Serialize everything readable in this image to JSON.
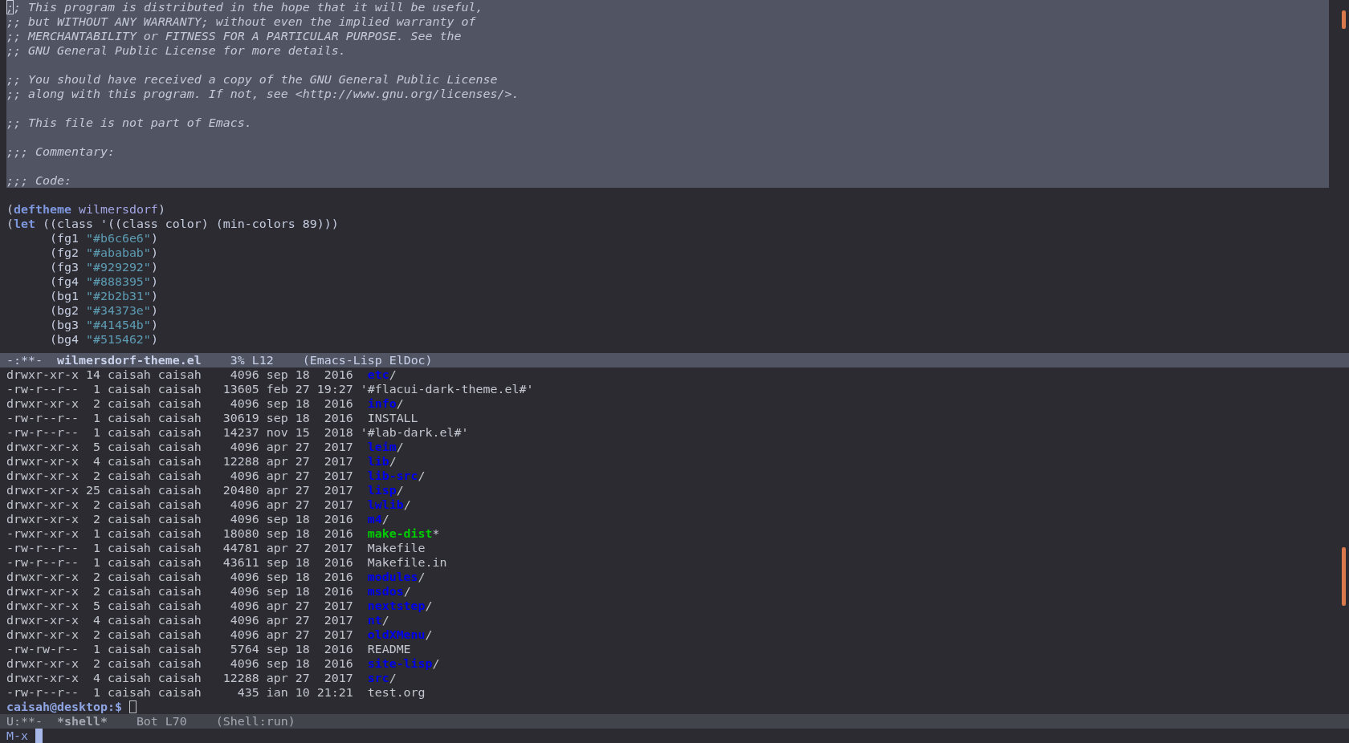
{
  "editor": {
    "lines": [
      {
        "region": true,
        "segments": [
          {
            "kind": "comment",
            "text": ";",
            "cursor": true
          },
          {
            "kind": "comment",
            "text": "; This program is distributed in the hope that it will be useful,",
            "cursor": false
          }
        ]
      },
      {
        "region": true,
        "segments": [
          {
            "kind": "comment",
            "text": ";; but WITHOUT ANY WARRANTY; without even the implied warranty of"
          }
        ]
      },
      {
        "region": true,
        "segments": [
          {
            "kind": "comment",
            "text": ";; MERCHANTABILITY or FITNESS FOR A PARTICULAR PURPOSE. See the"
          }
        ]
      },
      {
        "region": true,
        "segments": [
          {
            "kind": "comment",
            "text": ";; GNU General Public License for more details."
          }
        ]
      },
      {
        "region": true
      },
      {
        "region": true,
        "segments": [
          {
            "kind": "comment",
            "text": ";; You should have received a copy of the GNU General Public License"
          }
        ]
      },
      {
        "region": true,
        "segments": [
          {
            "kind": "comment",
            "text": ";; along with this program. If not, see <http://www.gnu.org/licenses/>."
          }
        ]
      },
      {
        "region": true
      },
      {
        "region": true,
        "segments": [
          {
            "kind": "comment",
            "text": ";; This file is not part of Emacs."
          }
        ]
      },
      {
        "region": true
      },
      {
        "region": true,
        "segments": [
          {
            "kind": "comment",
            "text": ";;; Commentary:"
          }
        ]
      },
      {
        "region": true
      },
      {
        "region": true,
        "segments": [
          {
            "kind": "comment",
            "text": ";;; Code:"
          }
        ]
      },
      {
        "region": false
      },
      {
        "region": false,
        "segments": [
          {
            "kind": "plain",
            "text": "("
          },
          {
            "kind": "keyword",
            "text": "deftheme"
          },
          {
            "kind": "name",
            "text": "wilmersdorf"
          },
          {
            "kind": "plain",
            "text": ")"
          }
        ]
      },
      {
        "region": false,
        "segments": [
          {
            "kind": "plain",
            "text": "("
          },
          {
            "kind": "keyword",
            "text": "let"
          },
          {
            "kind": "plain",
            "text": " ((class '((class color) (min-colors 89)))"
          }
        ]
      },
      {
        "region": false,
        "indented": true,
        "segments": [
          {
            "kind": "plain",
            "text": "(fg1 "
          },
          {
            "kind": "string",
            "text": "\"#b6c6e6\""
          },
          {
            "kind": "plain",
            "text": ")"
          }
        ]
      },
      {
        "region": false,
        "indented": true,
        "segments": [
          {
            "kind": "plain",
            "text": "(fg2 "
          },
          {
            "kind": "string",
            "text": "\"#ababab\""
          },
          {
            "kind": "plain",
            "text": ")"
          }
        ]
      },
      {
        "region": false,
        "indented": true,
        "segments": [
          {
            "kind": "plain",
            "text": "(fg3 "
          },
          {
            "kind": "string",
            "text": "\"#929292\""
          },
          {
            "kind": "plain",
            "text": ")"
          }
        ]
      },
      {
        "region": false,
        "indented": true,
        "segments": [
          {
            "kind": "plain",
            "text": "(fg4 "
          },
          {
            "kind": "string",
            "text": "\"#888395\""
          },
          {
            "kind": "plain",
            "text": ")"
          }
        ]
      },
      {
        "region": false,
        "indented": true,
        "segments": [
          {
            "kind": "plain",
            "text": "(bg1 "
          },
          {
            "kind": "string",
            "text": "\"#2b2b31\""
          },
          {
            "kind": "plain",
            "text": ")"
          }
        ]
      },
      {
        "region": false,
        "indented": true,
        "segments": [
          {
            "kind": "plain",
            "text": "(bg2 "
          },
          {
            "kind": "string",
            "text": "\"#34373e\""
          },
          {
            "kind": "plain",
            "text": ")"
          }
        ]
      },
      {
        "region": false,
        "indented": true,
        "segments": [
          {
            "kind": "plain",
            "text": "(bg3 "
          },
          {
            "kind": "string",
            "text": "\"#41454b\""
          },
          {
            "kind": "plain",
            "text": ")"
          }
        ]
      },
      {
        "region": false,
        "indented": true,
        "segments": [
          {
            "kind": "plain",
            "text": "(bg4 "
          },
          {
            "kind": "string",
            "text": "\"#515462\""
          },
          {
            "kind": "plain",
            "text": ")"
          }
        ]
      }
    ]
  },
  "editor_mode_line": {
    "active": true,
    "state": "-:**-",
    "buffer": "wilmersdorf-theme.el",
    "position": "3% L12",
    "modes": "(Emacs-Lisp ElDoc)"
  },
  "shell": {
    "rows": [
      {
        "details": "drwxr-xr-x 14 caisah caisah    4096 sep 18  2016",
        "kind": "dir",
        "name": "etc",
        "suffix": "/"
      },
      {
        "details": "-rw-r--r--  1 caisah caisah   13605 feb 27 19:27",
        "kind": "quoted",
        "name": "'#flacui-dark-theme.el#'"
      },
      {
        "details": "drwxr-xr-x  2 caisah caisah    4096 sep 18  2016",
        "kind": "dir",
        "name": "info",
        "suffix": "/"
      },
      {
        "details": "-rw-r--r--  1 caisah caisah   30619 sep 18  2016",
        "kind": "file",
        "name": "INSTALL"
      },
      {
        "details": "-rw-r--r--  1 caisah caisah   14237 nov 15  2018",
        "kind": "quoted",
        "name": "'#lab-dark.el#'"
      },
      {
        "details": "drwxr-xr-x  5 caisah caisah    4096 apr 27  2017",
        "kind": "dir",
        "name": "leim",
        "suffix": "/"
      },
      {
        "details": "drwxr-xr-x  4 caisah caisah   12288 apr 27  2017",
        "kind": "dir",
        "name": "lib",
        "suffix": "/"
      },
      {
        "details": "drwxr-xr-x  2 caisah caisah    4096 apr 27  2017",
        "kind": "dir",
        "name": "lib-src",
        "suffix": "/"
      },
      {
        "details": "drwxr-xr-x 25 caisah caisah   20480 apr 27  2017",
        "kind": "dir",
        "name": "lisp",
        "suffix": "/"
      },
      {
        "details": "drwxr-xr-x  2 caisah caisah    4096 apr 27  2017",
        "kind": "dir",
        "name": "lwlib",
        "suffix": "/"
      },
      {
        "details": "drwxr-xr-x  2 caisah caisah    4096 sep 18  2016",
        "kind": "dir",
        "name": "m4",
        "suffix": "/"
      },
      {
        "details": "-rwxr-xr-x  1 caisah caisah   18080 sep 18  2016",
        "kind": "exec",
        "name": "make-dist",
        "suffix": "*"
      },
      {
        "details": "-rw-r--r--  1 caisah caisah   44781 apr 27  2017",
        "kind": "file",
        "name": "Makefile"
      },
      {
        "details": "-rw-r--r--  1 caisah caisah   43611 sep 18  2016",
        "kind": "file",
        "name": "Makefile.in"
      },
      {
        "details": "drwxr-xr-x  2 caisah caisah    4096 sep 18  2016",
        "kind": "dir",
        "name": "modules",
        "suffix": "/"
      },
      {
        "details": "drwxr-xr-x  2 caisah caisah    4096 sep 18  2016",
        "kind": "dir",
        "name": "msdos",
        "suffix": "/"
      },
      {
        "details": "drwxr-xr-x  5 caisah caisah    4096 apr 27  2017",
        "kind": "dir",
        "name": "nextstep",
        "suffix": "/"
      },
      {
        "details": "drwxr-xr-x  4 caisah caisah    4096 apr 27  2017",
        "kind": "dir",
        "name": "nt",
        "suffix": "/"
      },
      {
        "details": "drwxr-xr-x  2 caisah caisah    4096 apr 27  2017",
        "kind": "dir",
        "name": "oldXMenu",
        "suffix": "/"
      },
      {
        "details": "-rw-rw-r--  1 caisah caisah    5764 sep 18  2016",
        "kind": "file",
        "name": "README"
      },
      {
        "details": "drwxr-xr-x  2 caisah caisah    4096 sep 18  2016",
        "kind": "dir",
        "name": "site-lisp",
        "suffix": "/"
      },
      {
        "details": "drwxr-xr-x  4 caisah caisah   12288 apr 27  2017",
        "kind": "dir",
        "name": "src",
        "suffix": "/"
      },
      {
        "details": "-rw-r--r--  1 caisah caisah     435 ian 10 21:21",
        "kind": "file",
        "name": "test.org"
      }
    ],
    "prompt": "caisah@desktop:$"
  },
  "shell_mode_line": {
    "active": false,
    "state": "U:**-",
    "buffer": "*shell*",
    "position": "Bot L70",
    "modes": "(Shell:run)"
  },
  "minibuffer": {
    "text": "M-x"
  }
}
